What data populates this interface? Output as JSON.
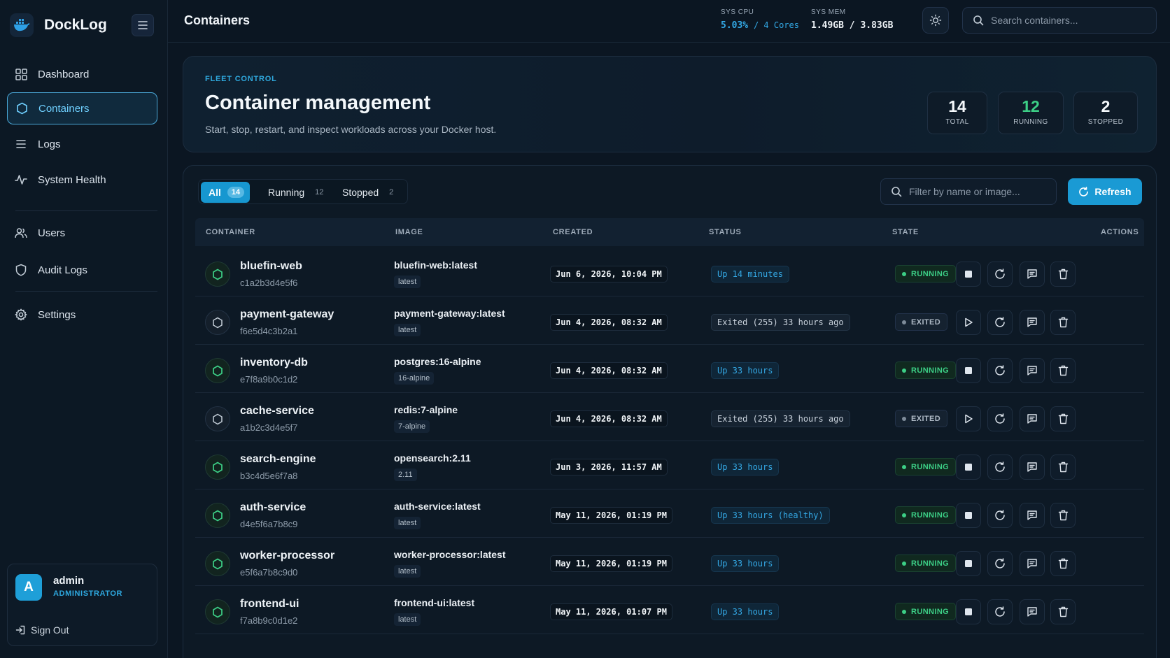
{
  "app": {
    "name": "DockLog"
  },
  "sidebar": {
    "items": [
      {
        "label": "Dashboard",
        "icon": "grid-icon"
      },
      {
        "label": "Containers",
        "icon": "hexagon-icon",
        "active": true
      },
      {
        "label": "Logs",
        "icon": "list-icon"
      },
      {
        "label": "System Health",
        "icon": "pulse-icon"
      },
      {
        "label": "Users",
        "icon": "users-icon"
      },
      {
        "label": "Audit Logs",
        "icon": "shield-icon"
      },
      {
        "label": "Settings",
        "icon": "gear-icon"
      }
    ],
    "user": {
      "initial": "A",
      "name": "admin",
      "role": "ADMINISTRATOR"
    },
    "signout_label": "Sign Out"
  },
  "header": {
    "title": "Containers",
    "cpu": {
      "label": "SYS CPU",
      "value": "5.03%",
      "cores": "/ 4 Cores"
    },
    "mem": {
      "label": "SYS MEM",
      "value": "1.49GB / 3.83GB"
    },
    "search_placeholder": "Search containers..."
  },
  "hero": {
    "eyebrow": "FLEET CONTROL",
    "title": "Container management",
    "subtitle": "Start, stop, restart, and inspect workloads across your Docker host.",
    "stats": [
      {
        "value": "14",
        "label": "TOTAL"
      },
      {
        "value": "12",
        "label": "RUNNING"
      },
      {
        "value": "2",
        "label": "STOPPED"
      }
    ]
  },
  "tabs": [
    {
      "label": "All",
      "count": "14",
      "active": true
    },
    {
      "label": "Running",
      "count": "12"
    },
    {
      "label": "Stopped",
      "count": "2"
    }
  ],
  "filter_placeholder": "Filter by name or image...",
  "refresh_label": "Refresh",
  "table": {
    "headers": [
      "CONTAINER",
      "IMAGE",
      "CREATED",
      "STATUS",
      "STATE",
      "ACTIONS"
    ],
    "rows": [
      {
        "name": "bluefin-web",
        "id": "c1a2b3d4e5f6",
        "image": "bluefin-web:latest",
        "tag": "latest",
        "created": "Jun 6, 2026, 10:04 PM",
        "status": "Up 14 minutes",
        "state": "RUNNING"
      },
      {
        "name": "payment-gateway",
        "id": "f6e5d4c3b2a1",
        "image": "payment-gateway:latest",
        "tag": "latest",
        "created": "Jun 4, 2026, 08:32 AM",
        "status": "Exited (255) 33 hours ago",
        "state": "EXITED"
      },
      {
        "name": "inventory-db",
        "id": "e7f8a9b0c1d2",
        "image": "postgres:16-alpine",
        "tag": "16-alpine",
        "created": "Jun 4, 2026, 08:32 AM",
        "status": "Up 33 hours",
        "state": "RUNNING"
      },
      {
        "name": "cache-service",
        "id": "a1b2c3d4e5f7",
        "image": "redis:7-alpine",
        "tag": "7-alpine",
        "created": "Jun 4, 2026, 08:32 AM",
        "status": "Exited (255) 33 hours ago",
        "state": "EXITED"
      },
      {
        "name": "search-engine",
        "id": "b3c4d5e6f7a8",
        "image": "opensearch:2.11",
        "tag": "2.11",
        "created": "Jun 3, 2026, 11:57 AM",
        "status": "Up 33 hours",
        "state": "RUNNING"
      },
      {
        "name": "auth-service",
        "id": "d4e5f6a7b8c9",
        "image": "auth-service:latest",
        "tag": "latest",
        "created": "May 11, 2026, 01:19 PM",
        "status": "Up 33 hours (healthy)",
        "state": "RUNNING"
      },
      {
        "name": "worker-processor",
        "id": "e5f6a7b8c9d0",
        "image": "worker-processor:latest",
        "tag": "latest",
        "created": "May 11, 2026, 01:19 PM",
        "status": "Up 33 hours",
        "state": "RUNNING"
      },
      {
        "name": "frontend-ui",
        "id": "f7a8b9c0d1e2",
        "image": "frontend-ui:latest",
        "tag": "latest",
        "created": "May 11, 2026, 01:07 PM",
        "status": "Up 33 hours",
        "state": "RUNNING"
      }
    ]
  },
  "colors": {
    "accent": "#1a9ad4",
    "running": "#3ccf86",
    "background": "#0b1622"
  }
}
